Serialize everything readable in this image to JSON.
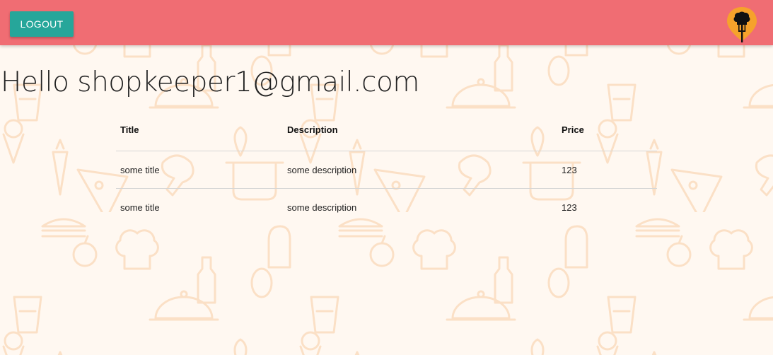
{
  "navbar": {
    "logout_label": "LOGOUT",
    "background_color": "#f06d73",
    "button_color": "#26a69a",
    "logo_icon": "chef-hat-fork-pin-icon"
  },
  "main": {
    "greeting": "Hello shopkeeper1@gmail.com",
    "table": {
      "headers": [
        "Title",
        "Description",
        "Price"
      ],
      "rows": [
        [
          "some title",
          "some description",
          "123"
        ],
        [
          "some title",
          "some description",
          "123"
        ]
      ]
    }
  },
  "background": {
    "pattern": "food-doodle-pattern",
    "color": "#fff7ef",
    "doodle_color": "#fbe3cc"
  }
}
